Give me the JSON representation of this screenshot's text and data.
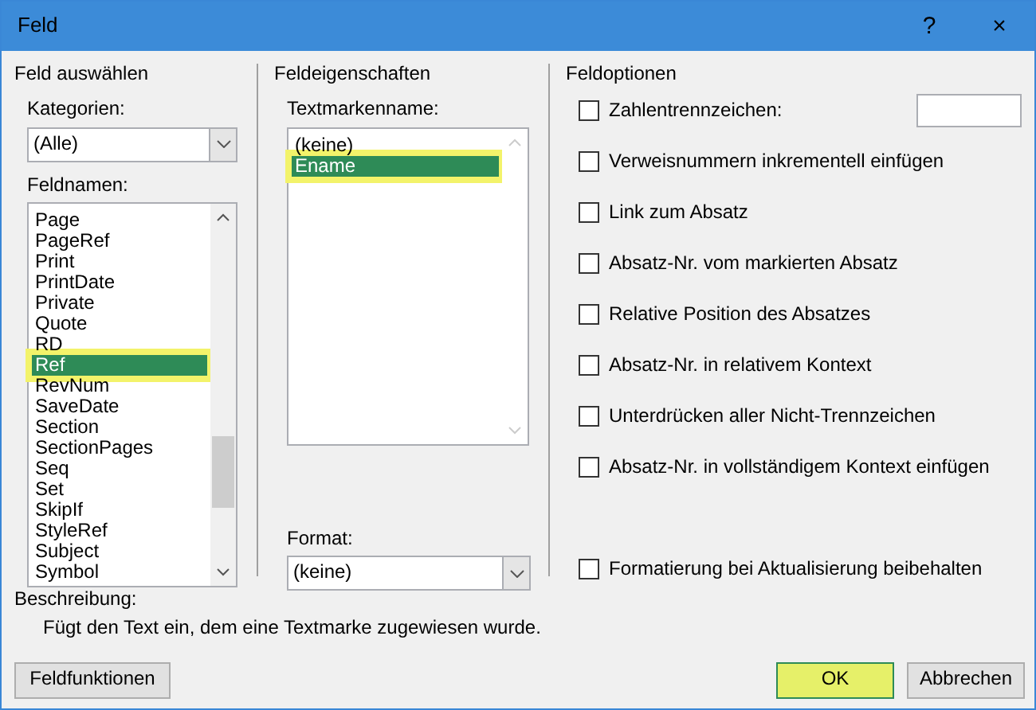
{
  "window": {
    "title": "Feld",
    "help": "?",
    "close": "×"
  },
  "select_field": {
    "title": "Feld auswählen",
    "categories_label": "Kategorien:",
    "categories_value": "(Alle)",
    "fieldnames_label": "Feldnamen:",
    "fieldnames": [
      {
        "label": "Page",
        "selected": false,
        "highlighted": false
      },
      {
        "label": "PageRef",
        "selected": false,
        "highlighted": false
      },
      {
        "label": "Print",
        "selected": false,
        "highlighted": false
      },
      {
        "label": "PrintDate",
        "selected": false,
        "highlighted": false
      },
      {
        "label": "Private",
        "selected": false,
        "highlighted": false
      },
      {
        "label": "Quote",
        "selected": false,
        "highlighted": false
      },
      {
        "label": "RD",
        "selected": false,
        "highlighted": false
      },
      {
        "label": "Ref",
        "selected": true,
        "highlighted": true
      },
      {
        "label": "RevNum",
        "selected": false,
        "highlighted": false
      },
      {
        "label": "SaveDate",
        "selected": false,
        "highlighted": false
      },
      {
        "label": "Section",
        "selected": false,
        "highlighted": false
      },
      {
        "label": "SectionPages",
        "selected": false,
        "highlighted": false
      },
      {
        "label": "Seq",
        "selected": false,
        "highlighted": false
      },
      {
        "label": "Set",
        "selected": false,
        "highlighted": false
      },
      {
        "label": "SkipIf",
        "selected": false,
        "highlighted": false
      },
      {
        "label": "StyleRef",
        "selected": false,
        "highlighted": false
      },
      {
        "label": "Subject",
        "selected": false,
        "highlighted": false
      },
      {
        "label": "Symbol",
        "selected": false,
        "highlighted": false
      }
    ]
  },
  "field_properties": {
    "title": "Feldeigenschaften",
    "bookmark_label": "Textmarkenname:",
    "bookmarks": [
      {
        "label": "(keine)",
        "selected": false,
        "highlighted": false
      },
      {
        "label": "Ename",
        "selected": true,
        "highlighted": true
      }
    ],
    "format_label": "Format:",
    "format_value": "(keine)"
  },
  "field_options": {
    "title": "Feldoptionen",
    "options": [
      {
        "label": "Zahlentrennzeichen:",
        "checked": false,
        "kind": "input"
      },
      {
        "label": "Verweisnummern inkrementell einfügen",
        "checked": false,
        "kind": "check"
      },
      {
        "label": "Link zum Absatz",
        "checked": false,
        "kind": "check"
      },
      {
        "label": "Absatz-Nr. vom markierten Absatz",
        "checked": false,
        "kind": "check"
      },
      {
        "label": "Relative Position des Absatzes",
        "checked": false,
        "kind": "check"
      },
      {
        "label": "Absatz-Nr. in relativem Kontext",
        "checked": false,
        "kind": "check"
      },
      {
        "label": "Unterdrücken aller Nicht-Trennzeichen",
        "checked": false,
        "kind": "check"
      },
      {
        "label": "Absatz-Nr. in vollständigem Kontext einfügen",
        "checked": false,
        "kind": "check"
      }
    ],
    "bottom_option": {
      "label": "Formatierung bei Aktualisierung beibehalten",
      "checked": false
    }
  },
  "description": {
    "label": "Beschreibung:",
    "text": "Fügt den Text ein, dem eine Textmarke zugewiesen wurde."
  },
  "buttons": [
    {
      "label": "Feldfunktionen",
      "kind": "left",
      "highlighted": false
    },
    {
      "label": "OK",
      "kind": "right",
      "highlighted": true
    },
    {
      "label": "Abbrechen",
      "kind": "right",
      "highlighted": false
    }
  ]
}
